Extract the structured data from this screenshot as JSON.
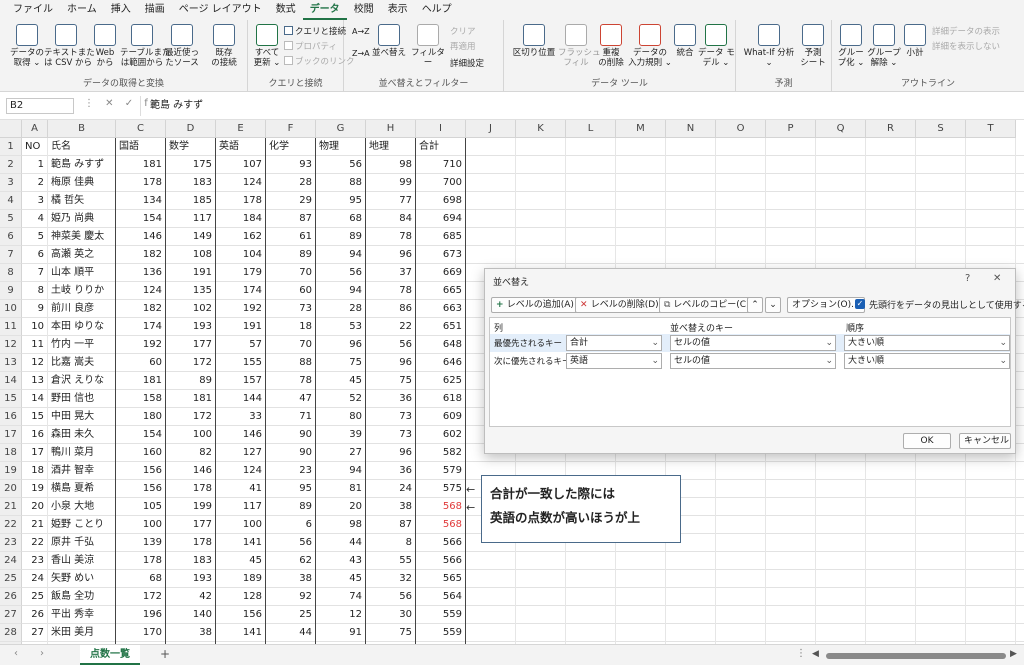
{
  "menu": [
    "ファイル",
    "ホーム",
    "挿入",
    "描画",
    "ページ レイアウト",
    "数式",
    "データ",
    "校閲",
    "表示",
    "ヘルプ"
  ],
  "menu_active": "データ",
  "ribbon": {
    "g1": {
      "label": "データの取得と変換",
      "btns": [
        "データの\n取得 ⌄",
        "テキストまた\nは CSV から",
        "Web\nから",
        "テーブルまた\nは範囲から",
        "最近使っ\nたソース",
        "既存\nの接続"
      ]
    },
    "g2": {
      "label": "クエリと接続",
      "big": "すべて\n更新 ⌄",
      "small": [
        "クエリと接続",
        "プロパティ",
        "ブックのリンク"
      ]
    },
    "g3": {
      "label": "並べ替えとフィルター",
      "sort_az": "A→Z",
      "sort_za": "Z→A",
      "sort": "並べ替え",
      "filter": "フィルター",
      "small": [
        "クリア",
        "再適用",
        "詳細設定"
      ]
    },
    "g4": {
      "label": "データ ツール",
      "btns": [
        "区切り位置",
        "フラッシュ\nフィル",
        "重複\nの削除",
        "データの\n入力規則 ⌄",
        "統合",
        "データ モ\nデル ⌄"
      ]
    },
    "g5": {
      "label": "予測",
      "btns": [
        "What-If 分析\n⌄",
        "予測\nシート"
      ]
    },
    "g6": {
      "label": "アウトライン",
      "btns": [
        "グルー\nプ化 ⌄",
        "グループ\n解除 ⌄",
        "小計"
      ],
      "small": [
        "詳細データの表示",
        "詳細を表示しない"
      ]
    }
  },
  "namebox": "B2",
  "formula": "範島 みすず",
  "fx_icons": "⋮ ✕ ✓ fx",
  "columns": [
    "A",
    "B",
    "C",
    "D",
    "E",
    "F",
    "G",
    "H",
    "I",
    "J",
    "K",
    "L",
    "M",
    "N",
    "O",
    "P",
    "Q",
    "R",
    "S",
    "T"
  ],
  "header_row": [
    "NO",
    "氏名",
    "国語",
    "数学",
    "英語",
    "化学",
    "物理",
    "地理",
    "合計"
  ],
  "rows": [
    [
      1,
      "範島 みすず",
      181,
      175,
      107,
      93,
      56,
      98,
      710
    ],
    [
      2,
      "梅原 佳典",
      178,
      183,
      124,
      28,
      88,
      99,
      700
    ],
    [
      3,
      "橘 哲矢",
      134,
      185,
      178,
      29,
      95,
      77,
      698
    ],
    [
      4,
      "姫乃 尚典",
      154,
      117,
      184,
      87,
      68,
      84,
      694
    ],
    [
      5,
      "神菜美 慶太",
      146,
      149,
      162,
      61,
      89,
      78,
      685
    ],
    [
      6,
      "高瀬 英之",
      182,
      108,
      104,
      89,
      94,
      96,
      673
    ],
    [
      7,
      "山本 順平",
      136,
      191,
      179,
      70,
      56,
      37,
      669
    ],
    [
      8,
      "土岐 りりか",
      124,
      135,
      174,
      60,
      94,
      78,
      665
    ],
    [
      9,
      "前川 良彦",
      182,
      102,
      192,
      73,
      28,
      86,
      663
    ],
    [
      10,
      "本田 ゆりな",
      174,
      193,
      191,
      18,
      53,
      22,
      651
    ],
    [
      11,
      "竹内 一平",
      192,
      177,
      57,
      70,
      96,
      56,
      648
    ],
    [
      12,
      "比嘉 嵩夫",
      60,
      172,
      155,
      88,
      75,
      96,
      646
    ],
    [
      13,
      "倉沢 えりな",
      181,
      89,
      157,
      78,
      45,
      75,
      625
    ],
    [
      14,
      "野田 信也",
      158,
      181,
      144,
      47,
      52,
      36,
      618
    ],
    [
      15,
      "中田 晃大",
      180,
      172,
      33,
      71,
      80,
      73,
      609
    ],
    [
      16,
      "森田 未久",
      154,
      100,
      146,
      90,
      39,
      73,
      602
    ],
    [
      17,
      "鴨川 菜月",
      160,
      82,
      127,
      90,
      27,
      96,
      582
    ],
    [
      18,
      "酒井 智幸",
      156,
      146,
      124,
      23,
      94,
      36,
      579
    ],
    [
      19,
      "横島 夏希",
      156,
      178,
      41,
      95,
      81,
      24,
      575
    ],
    [
      20,
      "小泉 大地",
      105,
      199,
      117,
      89,
      20,
      38,
      568
    ],
    [
      21,
      "姫野 ことり",
      100,
      177,
      100,
      6,
      98,
      87,
      568
    ],
    [
      22,
      "原井 千弘",
      139,
      178,
      141,
      56,
      44,
      8,
      566
    ],
    [
      23,
      "香山 美涼",
      178,
      183,
      45,
      62,
      43,
      55,
      566
    ],
    [
      24,
      "矢野 めい",
      68,
      193,
      189,
      38,
      45,
      32,
      565
    ],
    [
      25,
      "飯島 全功",
      172,
      42,
      128,
      92,
      74,
      56,
      564
    ],
    [
      26,
      "平出 秀幸",
      196,
      140,
      156,
      25,
      12,
      30,
      559
    ],
    [
      27,
      "米田 美月",
      170,
      38,
      141,
      44,
      91,
      75,
      559
    ],
    [
      28,
      "福本 慎二",
      155,
      198,
      42,
      60,
      58,
      45,
      558
    ]
  ],
  "red_rows": [
    19,
    20
  ],
  "sheet_tab": "点数一覧",
  "dialog": {
    "title": "並べ替え",
    "help": "?",
    "close": "✕",
    "add": "レベルの追加(A)",
    "delete": "レベルの削除(D)",
    "copy": "レベルのコピー(C)",
    "options": "オプション(O)...",
    "header_check": "先頭行をデータの見出しとして使用する(H)",
    "col_h": "列",
    "key_h": "並べ替えのキー",
    "order_h": "順序",
    "levels": [
      {
        "label": "最優先されるキー",
        "column": "合計",
        "key": "セルの値",
        "order": "大きい順"
      },
      {
        "label": "次に優先されるキー",
        "column": "英語",
        "key": "セルの値",
        "order": "大きい順"
      }
    ],
    "ok": "OK",
    "cancel": "キャンセル"
  },
  "callout": {
    "line1": "合計が一致した際には",
    "line2": "英語の点数が高いほうが上"
  }
}
